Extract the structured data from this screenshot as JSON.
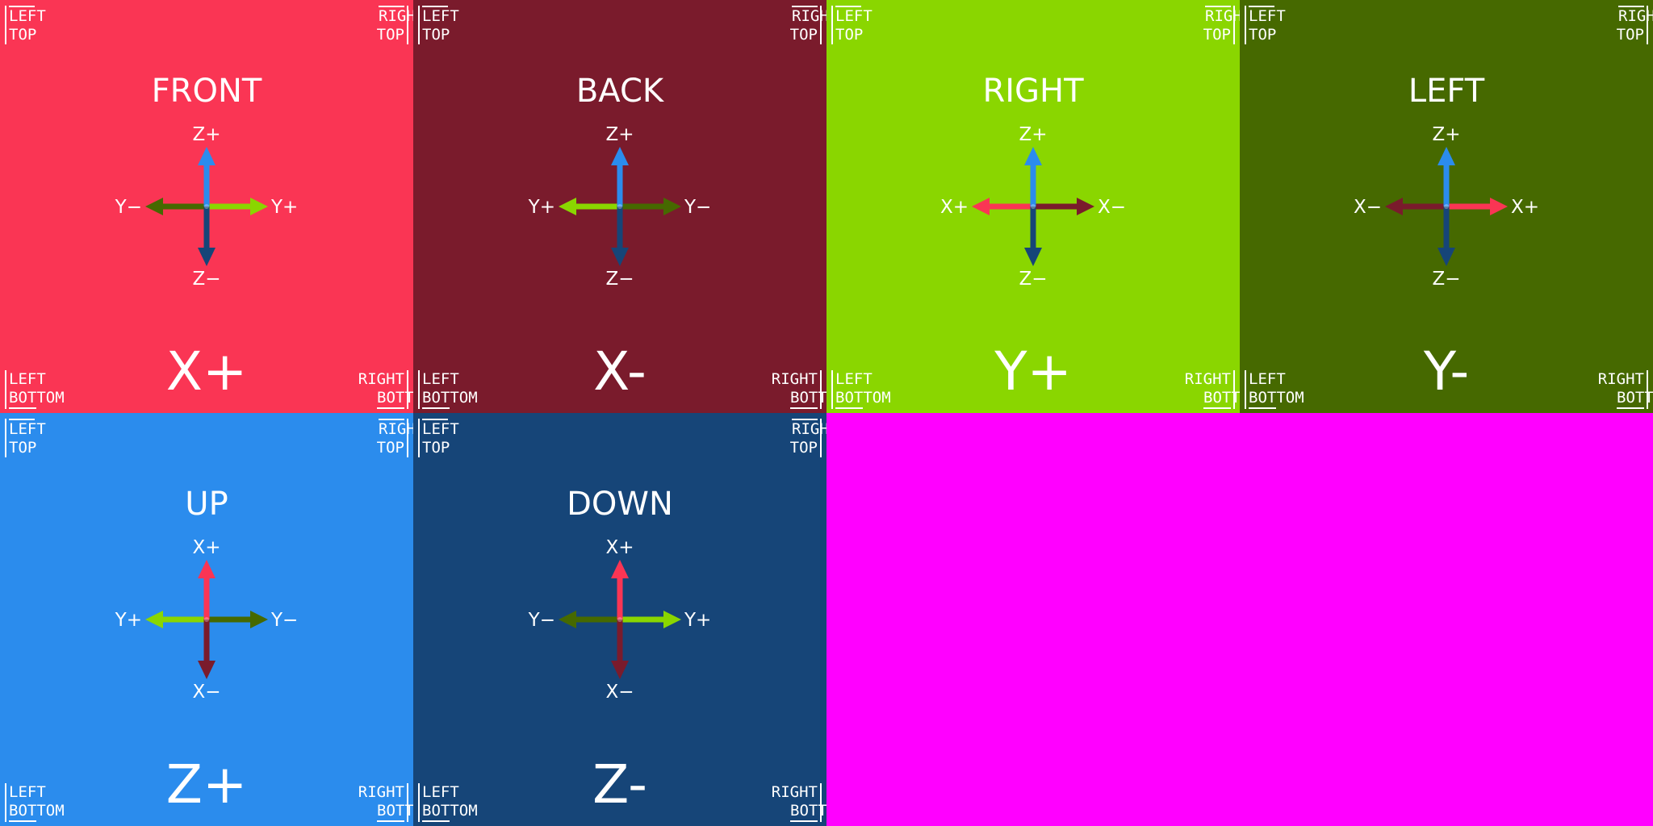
{
  "corners": {
    "left_top": [
      "LEFT",
      "TOP"
    ],
    "right_top": [
      "RIGHT",
      "TOP"
    ],
    "left_bottom": [
      "LEFT",
      "BOTTOM"
    ],
    "right_bottom": [
      "RIGHT",
      "BOTTOM"
    ]
  },
  "atlas": {
    "empty_area_color": "#ff00ff"
  },
  "faces": [
    {
      "title": "FRONT",
      "label": "X+",
      "bg": "#fa3554",
      "axes": {
        "up": {
          "label": "Z+",
          "color": "#2b8ced"
        },
        "down": {
          "label": "Z−",
          "color": "#164578"
        },
        "left": {
          "label": "Y−",
          "color": "#466900"
        },
        "right": {
          "label": "Y+",
          "color": "#8ad600"
        }
      }
    },
    {
      "title": "BACK",
      "label": "X-",
      "bg": "#7a1b2c",
      "axes": {
        "up": {
          "label": "Z+",
          "color": "#2b8ced"
        },
        "down": {
          "label": "Z−",
          "color": "#164578"
        },
        "left": {
          "label": "Y+",
          "color": "#8ad600"
        },
        "right": {
          "label": "Y−",
          "color": "#466900"
        }
      }
    },
    {
      "title": "RIGHT",
      "label": "Y+",
      "bg": "#8ad600",
      "axes": {
        "up": {
          "label": "Z+",
          "color": "#2b8ced"
        },
        "down": {
          "label": "Z−",
          "color": "#164578"
        },
        "left": {
          "label": "X+",
          "color": "#fa3554"
        },
        "right": {
          "label": "X−",
          "color": "#7a1b2c"
        }
      }
    },
    {
      "title": "LEFT",
      "label": "Y-",
      "bg": "#466900",
      "axes": {
        "up": {
          "label": "Z+",
          "color": "#2b8ced"
        },
        "down": {
          "label": "Z−",
          "color": "#164578"
        },
        "left": {
          "label": "X−",
          "color": "#7a1b2c"
        },
        "right": {
          "label": "X+",
          "color": "#fa3554"
        }
      }
    },
    {
      "title": "UP",
      "label": "Z+",
      "bg": "#2b8ced",
      "axes": {
        "up": {
          "label": "X+",
          "color": "#fa3554"
        },
        "down": {
          "label": "X−",
          "color": "#7a1b2c"
        },
        "left": {
          "label": "Y+",
          "color": "#8ad600"
        },
        "right": {
          "label": "Y−",
          "color": "#466900"
        }
      }
    },
    {
      "title": "DOWN",
      "label": "Z-",
      "bg": "#164578",
      "axes": {
        "up": {
          "label": "X+",
          "color": "#fa3554"
        },
        "down": {
          "label": "X−",
          "color": "#7a1b2c"
        },
        "left": {
          "label": "Y−",
          "color": "#466900"
        },
        "right": {
          "label": "Y+",
          "color": "#8ad600"
        }
      }
    }
  ]
}
